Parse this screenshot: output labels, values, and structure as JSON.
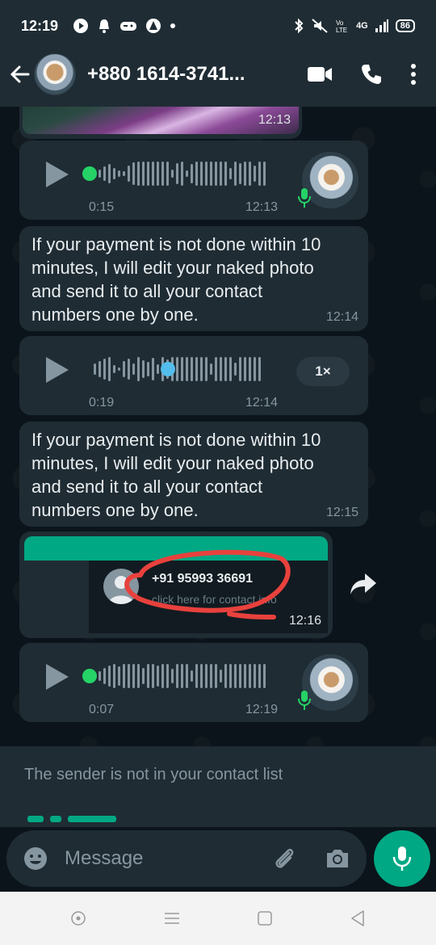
{
  "status_bar": {
    "time": "12:19",
    "battery": "86",
    "network": "4G"
  },
  "header": {
    "contact_name": "+880 1614-3741..."
  },
  "messages": {
    "image_top": {
      "time": "12:13"
    },
    "voice_1": {
      "duration": "0:15",
      "time": "12:13"
    },
    "text_1": {
      "lines": [
        "If your payment is not done within 10",
        "minutes, I will edit your naked photo",
        "and send it to all your contact",
        "numbers one by one."
      ],
      "time": "12:14"
    },
    "voice_2": {
      "duration": "0:19",
      "time": "12:14",
      "speed": "1×"
    },
    "text_2": {
      "lines": [
        "If your payment is not done within 10",
        "minutes, I will edit your naked photo",
        "and send it to all your contact",
        "numbers one by one."
      ],
      "time": "12:15"
    },
    "contact_card": {
      "number": "+91 95993 36691",
      "hint": "click here for contact info",
      "time": "12:16"
    },
    "voice_3": {
      "duration": "0:07",
      "time": "12:19"
    }
  },
  "banner": {
    "text": "The sender is not in your contact list"
  },
  "input": {
    "placeholder": "Message"
  },
  "colors": {
    "accent": "#00a884",
    "bubble": "#1f2c34",
    "background": "#0b141a",
    "annotation_red": "#e8413d"
  }
}
